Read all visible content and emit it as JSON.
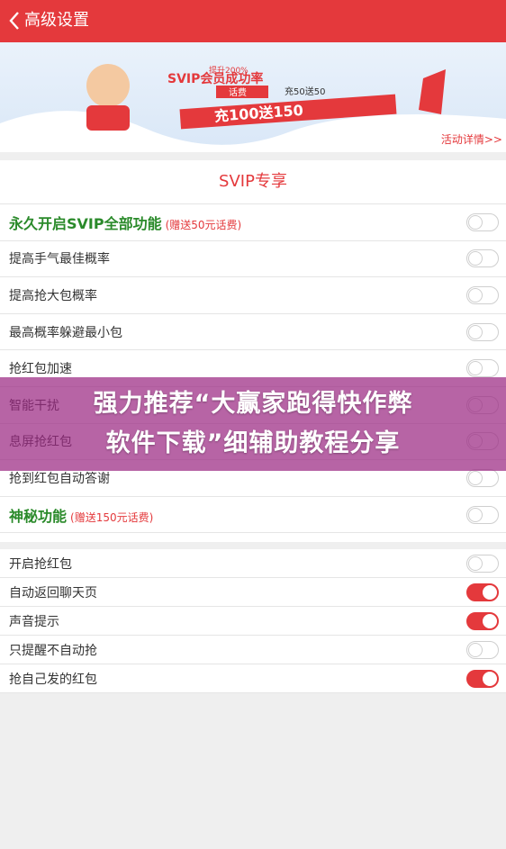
{
  "header": {
    "title": "高级设置",
    "back_icon": "chevron-left-icon"
  },
  "banner": {
    "headline": "SVIP会员成功率",
    "sub": "提升200%",
    "tag": "话费",
    "offer_small": "充50送50",
    "offer_big": "充100送150",
    "link": "活动详情>>"
  },
  "svip": {
    "section_title": "SVIP专享",
    "rows": [
      {
        "label": "永久开启SVIP全部功能",
        "gift": "(赠送50元话费)",
        "on": false
      },
      {
        "label": "提高手气最佳概率",
        "on": false
      },
      {
        "label": "提高抢大包概率",
        "on": false
      },
      {
        "label": "最高概率躲避最小包",
        "on": false
      },
      {
        "label": "抢红包加速",
        "on": false
      },
      {
        "label": "智能干扰",
        "on": false
      },
      {
        "label": "息屏抢红包",
        "on": false
      },
      {
        "label": "抢到红包自动答谢",
        "on": false
      },
      {
        "label": "神秘功能",
        "gift": "(赠送150元话费)",
        "on": false
      }
    ]
  },
  "basic": {
    "rows": [
      {
        "label": "开启抢红包",
        "on": false
      },
      {
        "label": "自动返回聊天页",
        "on": true
      },
      {
        "label": "声音提示",
        "on": true
      },
      {
        "label": "只提醒不自动抢",
        "on": false
      },
      {
        "label": "抢自己发的红包",
        "on": true
      }
    ]
  },
  "overlay": {
    "line1": "强力推荐“大赢家跑得快作弊",
    "line2": "软件下载”细辅助教程分享"
  },
  "colors": {
    "primary": "#e4393c",
    "green": "#2a8a2a",
    "overlay": "#9b2882"
  }
}
